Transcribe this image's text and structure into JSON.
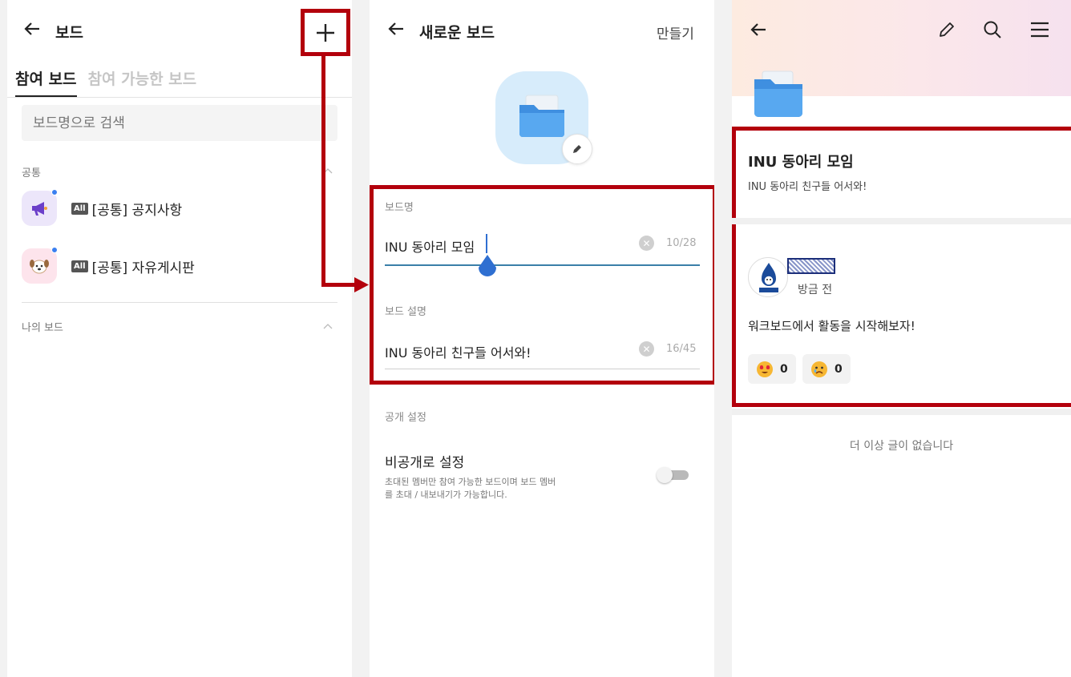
{
  "panel1": {
    "title": "보드",
    "tabs": [
      {
        "label": "참여 보드",
        "active": true
      },
      {
        "label": "참여 가능한 보드",
        "active": false
      }
    ],
    "search_placeholder": "보드명으로 검색",
    "sections": [
      {
        "label": "공통",
        "items": [
          {
            "badge": "All",
            "name": "[공통] 공지사항",
            "icon": "megaphone-icon"
          },
          {
            "badge": "All",
            "name": "[공통] 자유게시판",
            "icon": "dog-icon"
          }
        ]
      },
      {
        "label": "나의 보드",
        "items": []
      }
    ]
  },
  "panel2": {
    "title": "새로운 보드",
    "action_label": "만들기",
    "board_name": {
      "label": "보드명",
      "value": "INU 동아리 모임",
      "count": "10/28"
    },
    "board_desc": {
      "label": "보드 설명",
      "value": "INU 동아리 친구들 어서와!",
      "count": "16/45"
    },
    "visibility": {
      "section_label": "공개 설정",
      "title": "비공개로 설정",
      "desc_line1": "초대된 멤버만 참여 가능한 보드이며 보드 멤버",
      "desc_line2": "를 초대 / 내보내기가 가능합니다.",
      "enabled": false
    }
  },
  "panel3": {
    "board_title": "INU 동아리 모임",
    "board_desc": "INU 동아리 친구들 어서와!",
    "post": {
      "time": "방금 전",
      "body": "워크보드에서 활동을 시작해보자!",
      "reactions": [
        {
          "icon": "heart-eyes-emoji-icon",
          "count": "0"
        },
        {
          "icon": "sad-emoji-icon",
          "count": "0"
        }
      ]
    },
    "end_message": "더 이상 글이 없습니다"
  },
  "colors": {
    "highlight": "#b3000c",
    "accent_blue": "#3a7ff0",
    "folder_blue": "#4a9ee8",
    "tile_bg": "#d7ecfb"
  }
}
